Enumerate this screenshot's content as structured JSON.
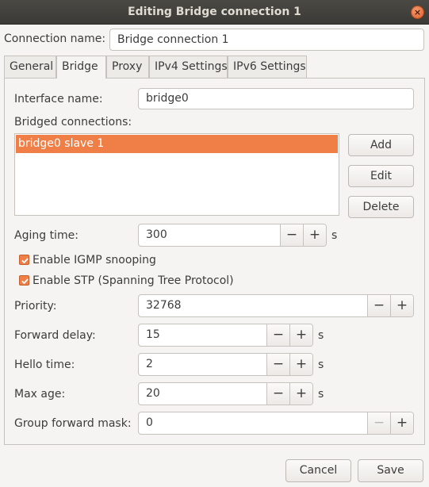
{
  "window": {
    "title": "Editing Bridge connection 1",
    "close_glyph": "×"
  },
  "connection_name": {
    "label": "Connection name:",
    "value": "Bridge connection 1"
  },
  "tabs": [
    {
      "label": "General"
    },
    {
      "label": "Bridge"
    },
    {
      "label": "Proxy"
    },
    {
      "label": "IPv4 Settings"
    },
    {
      "label": "IPv6 Settings"
    }
  ],
  "active_tab": "Bridge",
  "bridge": {
    "interface_name": {
      "label": "Interface name:",
      "value": "bridge0"
    },
    "bridged_connections": {
      "label": "Bridged connections:",
      "items": [
        "bridge0 slave 1"
      ],
      "selected_index": 0
    },
    "list_buttons": {
      "add": "Add",
      "edit": "Edit",
      "delete": "Delete"
    },
    "aging_time": {
      "label": "Aging time:",
      "value": "300",
      "unit": "s"
    },
    "igmp_snooping": {
      "label": "Enable IGMP snooping",
      "checked": true
    },
    "stp": {
      "label": "Enable STP (Spanning Tree Protocol)",
      "checked": true
    },
    "priority": {
      "label": "Priority:",
      "value": "32768"
    },
    "forward_delay": {
      "label": "Forward delay:",
      "value": "15",
      "unit": "s"
    },
    "hello_time": {
      "label": "Hello time:",
      "value": "2",
      "unit": "s"
    },
    "max_age": {
      "label": "Max age:",
      "value": "20",
      "unit": "s"
    },
    "group_forward_mask": {
      "label": "Group forward mask:",
      "value": "0",
      "minus_disabled": true
    }
  },
  "spin_glyphs": {
    "minus": "−",
    "plus": "+"
  },
  "footer": {
    "cancel": "Cancel",
    "save": "Save"
  },
  "colors": {
    "accent": "#ef7f46",
    "titlebar": "#3b3a36",
    "close_button": "#e1602a"
  }
}
